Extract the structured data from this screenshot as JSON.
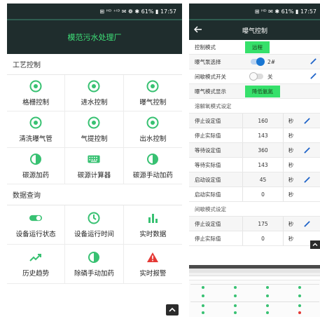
{
  "status_bar": {
    "left_phone": "⊞ ᴴᴰ ⁺ᴵᴰ ✉ ❁ ✱ 61% ▮ 17:57",
    "right_phone": "⊞ ᴴᴰ ✉ ✱ 61% ▮ 17:57"
  },
  "left": {
    "app_title": "模范污水处理厂",
    "sections": [
      {
        "title": "工艺控制",
        "items": [
          {
            "label": "格栅控制",
            "icon": "target-icon"
          },
          {
            "label": "进水控制",
            "icon": "target-icon"
          },
          {
            "label": "曝气控制",
            "icon": "target-icon"
          },
          {
            "label": "清洗曝气管",
            "icon": "target-icon"
          },
          {
            "label": "气提控制",
            "icon": "target-icon"
          },
          {
            "label": "出水控制",
            "icon": "target-icon"
          },
          {
            "label": "碳源加药",
            "icon": "half-circle-icon"
          },
          {
            "label": "碳源计算器",
            "icon": "keyboard-icon"
          },
          {
            "label": "碳源手动加药",
            "icon": "half-circle-icon"
          }
        ]
      },
      {
        "title": "数据查询",
        "items": [
          {
            "label": "设备运行状态",
            "icon": "toggle-icon"
          },
          {
            "label": "设备运行时间",
            "icon": "clock-icon"
          },
          {
            "label": "实时数据",
            "icon": "bar-chart-icon"
          },
          {
            "label": "历史趋势",
            "icon": "trend-icon"
          },
          {
            "label": "除磷手动加药",
            "icon": "half-circle-icon"
          },
          {
            "label": "实时报警",
            "icon": "warning-icon"
          }
        ]
      }
    ]
  },
  "right": {
    "page_title": "曝气控制",
    "control_mode_label": "控制模式",
    "control_mode_value": "远程",
    "pump_select_label": "曝气泵选择",
    "pump_select_value": "2#",
    "pump_toggle_on": true,
    "intermittent_switch_label": "间歇模式开关",
    "intermittent_switch_value": "关",
    "intermittent_toggle_on": false,
    "aeration_display_label": "曝气模式显示",
    "aeration_display_value": "降低氨氮",
    "dissolved_oxygen_section": "溶解氧模式设定",
    "rows_do": [
      {
        "label": "停止设定值",
        "value": "160",
        "unit": "秒",
        "editable": true
      },
      {
        "label": "停止实际值",
        "value": "143",
        "unit": "秒",
        "editable": false
      },
      {
        "label": "等待设定值",
        "value": "360",
        "unit": "秒",
        "editable": true
      },
      {
        "label": "等待实际值",
        "value": "143",
        "unit": "秒",
        "editable": false
      },
      {
        "label": "启动设定值",
        "value": "45",
        "unit": "秒",
        "editable": true
      },
      {
        "label": "启动实际值",
        "value": "0",
        "unit": "秒",
        "editable": false
      }
    ],
    "intermittent_section": "间歇模式设定",
    "rows_int": [
      {
        "label": "停止设定值",
        "value": "175",
        "unit": "秒",
        "editable": true
      },
      {
        "label": "停止实际值",
        "value": "0",
        "unit": "秒",
        "editable": false
      }
    ]
  },
  "colors": {
    "header_bg": "#1f2d2d",
    "accent_green": "#36e06b",
    "edit_blue": "#1e63c8",
    "warning_red": "#e53935"
  }
}
